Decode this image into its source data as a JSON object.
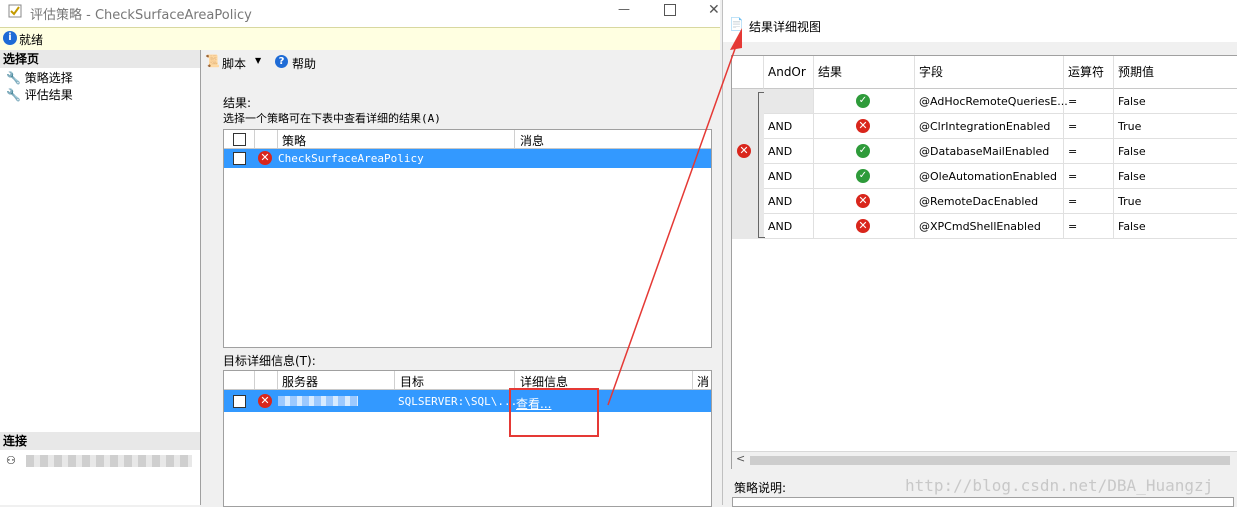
{
  "window": {
    "title": "评估策略 - CheckSurfaceAreaPolicy",
    "status": "就绪"
  },
  "left_pane": {
    "select_page_header": "选择页",
    "items": [
      {
        "label": "策略选择"
      },
      {
        "label": "评估结果"
      }
    ],
    "connect_header": "连接"
  },
  "toolbar": {
    "script_label": "脚本",
    "help_label": "帮助"
  },
  "results": {
    "label": "结果:",
    "hint": "选择一个策略可在下表中查看详细的结果(A)",
    "columns": {
      "policy": "策略",
      "message": "消息"
    },
    "rows": [
      {
        "policy": "CheckSurfaceAreaPolicy",
        "message": "",
        "status": "error"
      }
    ]
  },
  "target_details": {
    "label": "目标详细信息(T):",
    "columns": {
      "server": "服务器",
      "target": "目标",
      "details": "详细信息",
      "message": "消"
    },
    "rows": [
      {
        "server": "",
        "target": "SQLSERVER:\\SQL\\...",
        "details": "查看...",
        "status": "error"
      }
    ]
  },
  "detail_view": {
    "title": "结果详细视图",
    "columns": {
      "andor": "AndOr",
      "result": "结果",
      "field": "字段",
      "operator": "运算符",
      "expected": "预期值"
    },
    "rows": [
      {
        "andor": "",
        "result": "ok",
        "field": "@AdHocRemoteQueriesE...",
        "operator": "=",
        "expected": "False"
      },
      {
        "andor": "AND",
        "result": "error",
        "field": "@ClrIntegrationEnabled",
        "operator": "=",
        "expected": "True"
      },
      {
        "andor": "AND",
        "result": "ok",
        "field": "@DatabaseMailEnabled",
        "operator": "=",
        "expected": "False"
      },
      {
        "andor": "AND",
        "result": "ok",
        "field": "@OleAutomationEnabled",
        "operator": "=",
        "expected": "False"
      },
      {
        "andor": "AND",
        "result": "error",
        "field": "@RemoteDacEnabled",
        "operator": "=",
        "expected": "True"
      },
      {
        "andor": "AND",
        "result": "error",
        "field": "@XPCmdShellEnabled",
        "operator": "=",
        "expected": "False"
      }
    ],
    "policy_desc_label": "策略说明:"
  },
  "watermark": "http://blog.csdn.net/DBA_Huangzj",
  "colors": {
    "error": "#d9261c",
    "ok": "#2e9b3a",
    "selection": "#3399ff",
    "annotation": "#e53935"
  }
}
